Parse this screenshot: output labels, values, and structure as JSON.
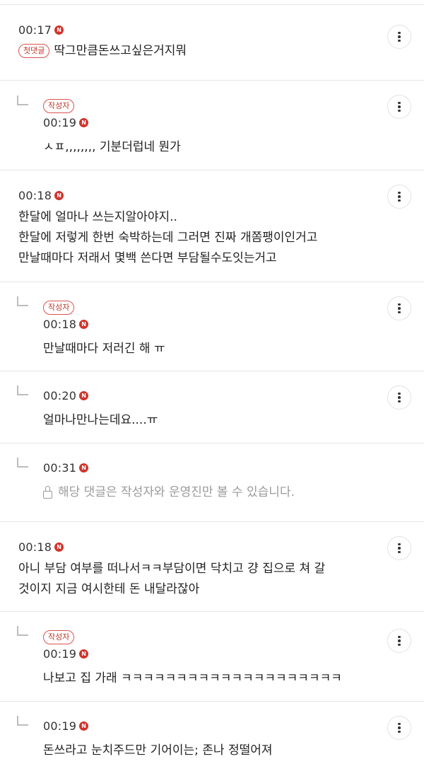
{
  "badges": {
    "author": "작성자",
    "first": "첫댓글",
    "new": "N"
  },
  "comments": [
    {
      "time": "00:17",
      "text": "딱그만큼돈쓰고싶은거지뭐"
    },
    {
      "time": "00:19",
      "text": "ㅅㅍ,,,,,,,, 기분더럽네 뭔가"
    },
    {
      "time": "00:18",
      "lines": [
        "한달에 얼마나 쓰는지알아야지..",
        "한달에 저렇게 한번 숙박하는데 그러면 진짜 개쫌팽이인거고",
        "만날때마다 저래서 몇백 쓴다면 부담될수도잇는거고"
      ]
    },
    {
      "time": "00:18",
      "text": "만날때마다 저러긴 해 ㅠ"
    },
    {
      "time": "00:20",
      "text": "얼마나만나는데요....ㅠ"
    },
    {
      "time": "00:31",
      "text": "해당 댓글은 작성자와 운영진만 볼 수 있습니다."
    },
    {
      "time": "00:18",
      "lines": [
        "아니 부담 여부를 떠나서ㅋㅋ부담이면 닥치고 걍 집으로 쳐 갈",
        "것이지 지금 여시한테 돈 내달라잖아"
      ]
    },
    {
      "time": "00:19",
      "text": "나보고 집 가래 ㅋㅋㅋㅋㅋㅋㅋㅋㅋㅋㅋㅋㅋㅋㅋㅋㅋㅋㅋㅋ"
    },
    {
      "time": "00:19",
      "text": "돈쓰라고 눈치주드만 기어이는; 존나 정떨어져"
    }
  ]
}
